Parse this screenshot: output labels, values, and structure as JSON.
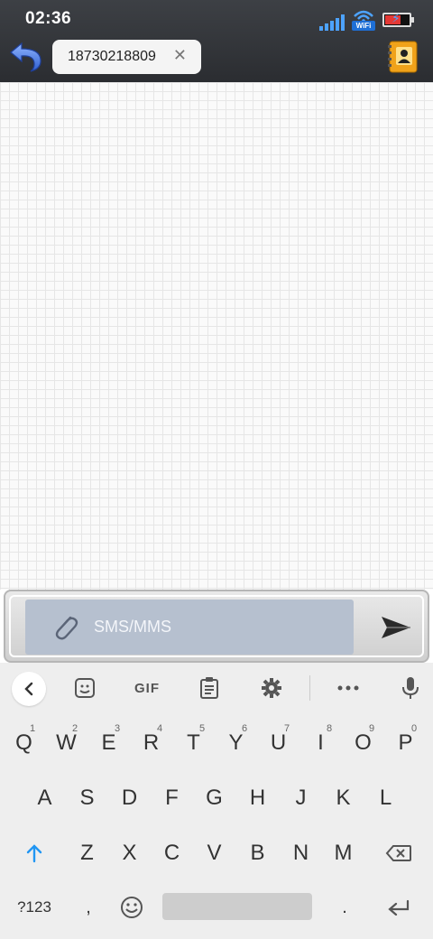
{
  "status": {
    "time": "02:36",
    "wifi_label": "WiFi",
    "icons": [
      "signal-icon",
      "wifi-icon",
      "battery-charging-icon"
    ]
  },
  "header": {
    "recipient": "18730218809",
    "clear_glyph": "✕",
    "icons": [
      "back-arrow-icon",
      "contacts-book-icon"
    ]
  },
  "compose": {
    "placeholder": "SMS/MMS",
    "icons": [
      "paperclip-icon",
      "send-icon"
    ]
  },
  "keyboard": {
    "toolbar": {
      "gif_label": "GIF",
      "icons": [
        "chevron-left-icon",
        "sticker-icon",
        "clipboard-icon",
        "gear-icon",
        "more-icon",
        "microphone-icon"
      ]
    },
    "row1": [
      "Q",
      "W",
      "E",
      "R",
      "T",
      "Y",
      "U",
      "I",
      "O",
      "P"
    ],
    "row1_numbers": [
      "1",
      "2",
      "3",
      "4",
      "5",
      "6",
      "7",
      "8",
      "9",
      "0"
    ],
    "row2": [
      "A",
      "S",
      "D",
      "F",
      "G",
      "H",
      "J",
      "K",
      "L"
    ],
    "row3": [
      "Z",
      "X",
      "C",
      "V",
      "B",
      "N",
      "M"
    ],
    "symbols_key": "?123",
    "comma_key": ",",
    "period_key": ".",
    "icons": [
      "shift-icon",
      "backspace-icon",
      "emoji-icon",
      "enter-icon"
    ]
  },
  "colors": {
    "topbar": "#2b2d31",
    "compose_field": "#b6c0cf",
    "keyboard_bg": "#eeeeee",
    "shift_accent": "#2196f3"
  }
}
